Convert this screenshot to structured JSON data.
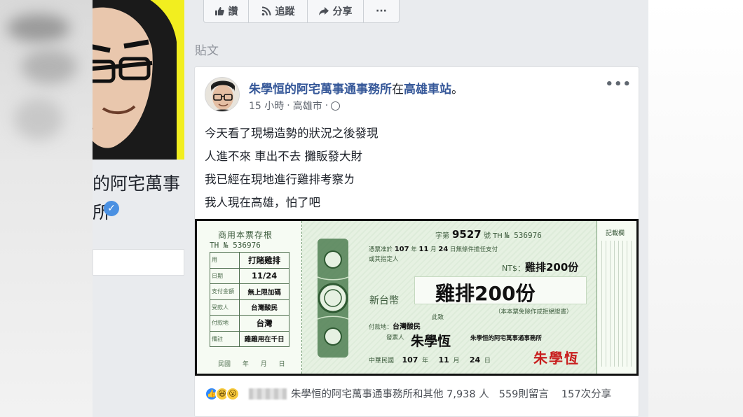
{
  "left": {
    "page_name_line1": "的阿宅萬事",
    "page_name_line2": "所"
  },
  "actions": {
    "like": "讚",
    "follow": "追蹤",
    "share": "分享",
    "more": "···"
  },
  "section_title": "貼文",
  "post": {
    "author": "朱學恒的阿宅萬事通事務所",
    "at": "在",
    "place": "高雄車站",
    "period": "。",
    "time": "15 小時",
    "location": "高雄市",
    "more": "•••",
    "lines": [
      "今天看了現場造勢的狀況之後發現",
      "人進不來 車出不去 攤販發大財",
      "我已經在現地進行雞排考察ㄌ",
      "我人現在高雄，怕了吧"
    ]
  },
  "cheque": {
    "stub_title": "商用本票存根",
    "stub_no": "TH  № 536976",
    "stub_rows": [
      {
        "label": "用",
        "value": "打賭雞排"
      },
      {
        "label": "日期",
        "value": "11/24"
      },
      {
        "label": "支付金額",
        "value": "無上限加碼"
      },
      {
        "label": "受款人",
        "value": "台灣酸民"
      },
      {
        "label": "付款地",
        "value": "台灣"
      },
      {
        "label": "備註",
        "value": "雞雞用在千日"
      }
    ],
    "stub_date": "民國 年 月 日",
    "zi_label": "字第",
    "zi_no": "9527",
    "hao": "號 TH",
    "serial": "№ 536976",
    "line1_pre": "憑票准於",
    "line1_year": "107",
    "line1_mid": "年",
    "line1_month": "11",
    "line1_mid2": "月",
    "line1_day": "24",
    "line1_post": "日無條件擔任支付",
    "line2": "或其指定人",
    "nt_label": "NT$：",
    "nt_amount": "雞排200份",
    "currency_label": "新台幣",
    "amount": "雞排200份",
    "note": "（本本票免除作成拒絕證書）",
    "pay_place_label": "付款地：",
    "pay_place_small": "此致",
    "pay_place": "台灣酸民",
    "issuer_label": "發票人",
    "issuer_sig": "朱學恆",
    "issuer_name": "朱學恒的阿宅萬事通事務所",
    "red_sig": "朱學恆",
    "date_pre": "中華民國",
    "date_year": "107",
    "date_y": "年",
    "date_month": "11",
    "date_m": "月",
    "date_day": "24",
    "date_d": "日",
    "notes_title": "記載欄"
  },
  "reactions": {
    "summary": "朱學恒的阿宅萬事通事務所和其他 7,938 人",
    "comments": "559則留言",
    "shares": "157次分享"
  }
}
